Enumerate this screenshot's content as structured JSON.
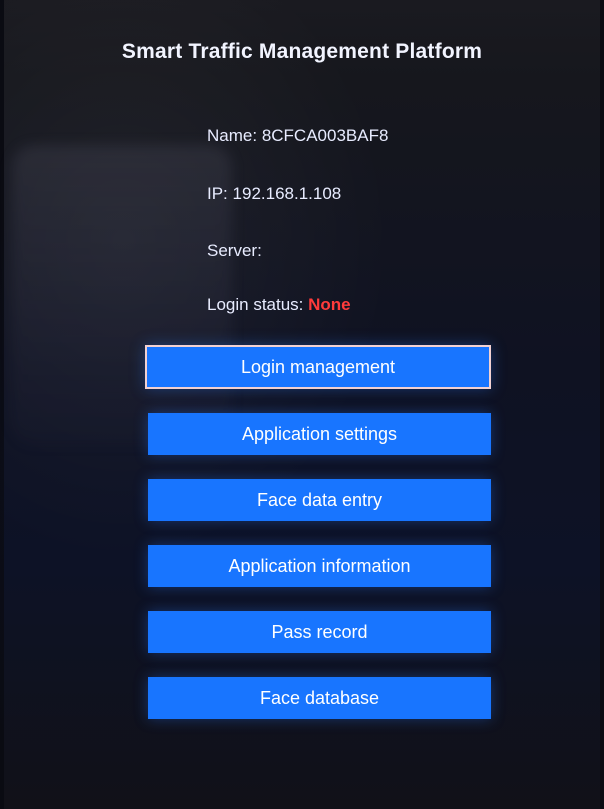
{
  "app": {
    "title": "Smart Traffic Management Platform"
  },
  "device_info": {
    "name_label": "Name:",
    "name_value": "8CFCA003BAF8",
    "ip_label": "IP:",
    "ip_value": "192.168.1.108",
    "server_label": "Server:",
    "server_value": "",
    "login_status_label": "Login status:",
    "login_status_value": "None"
  },
  "menu": {
    "buttons": [
      {
        "label": "Login management",
        "selected": true
      },
      {
        "label": "Application settings",
        "selected": false
      },
      {
        "label": "Face data entry",
        "selected": false
      },
      {
        "label": "Application information",
        "selected": false
      },
      {
        "label": "Pass record",
        "selected": false
      },
      {
        "label": "Face database",
        "selected": false
      }
    ]
  },
  "colors": {
    "button_blue": "#1875ff",
    "status_red": "#ff3b3b",
    "selected_border": "#f3d1d1"
  }
}
